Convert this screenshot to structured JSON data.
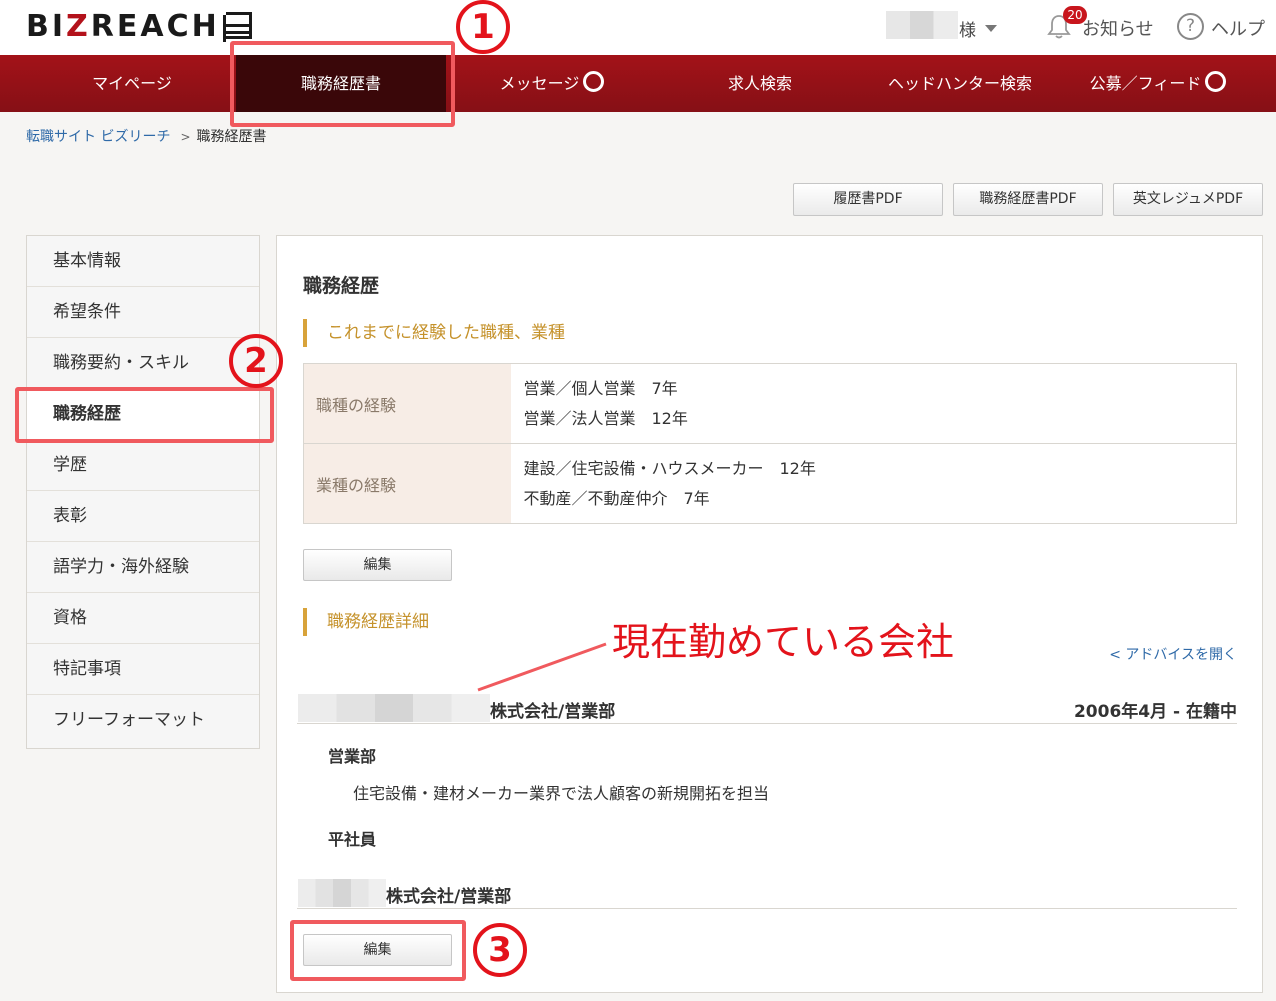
{
  "header": {
    "logo": "BIZREACH",
    "user_suffix": "様",
    "notice_badge": "20",
    "notice_label": "お知らせ",
    "help_glyph": "?",
    "help_label": "ヘルプ"
  },
  "nav": {
    "items": [
      {
        "label": "マイページ"
      },
      {
        "label": "職務経歴書"
      },
      {
        "label": "メッセージ"
      },
      {
        "label": "求人検索"
      },
      {
        "label": "ヘッドハンター検索"
      },
      {
        "label": "公募／フィード"
      }
    ]
  },
  "breadcrumb": {
    "home": "転職サイト ビズリーチ",
    "sep": ">",
    "current": "職務経歴書"
  },
  "pdf_buttons": [
    "履歴書PDF",
    "職務経歴書PDF",
    "英文レジュメPDF"
  ],
  "sidebar": {
    "items": [
      "基本情報",
      "希望条件",
      "職務要約・スキル",
      "職務経歴",
      "学歴",
      "表彰",
      "語学力・海外経験",
      "資格",
      "特記事項",
      "フリーフォーマット"
    ]
  },
  "main": {
    "title": "職務経歴",
    "experience_heading": "これまでに経験した職種、業種",
    "experience": [
      {
        "label": "職種の経験",
        "lines": [
          "営業／個人営業　7年",
          "営業／法人営業　12年"
        ]
      },
      {
        "label": "業種の経験",
        "lines": [
          "建設／住宅設備・ハウスメーカー　12年",
          "不動産／不動産仲介　7年"
        ]
      }
    ],
    "edit_label": "編集",
    "detail_heading": "職務経歴詳細",
    "advice_link": "< アドバイスを開く",
    "company1": {
      "name": "株式会社/営業部",
      "period": "2006年4月 - 在籍中",
      "department": "営業部",
      "description": "住宅設備・建材メーカー業界で法人顧客の新規開拓を担当",
      "role": "平社員"
    },
    "company2": {
      "name": "株式会社/営業部"
    }
  },
  "annotations": {
    "num1": "1",
    "num2": "2",
    "num3": "3",
    "current_company_note": "現在勤めている会社"
  },
  "colors": {
    "brand_red": "#a31218",
    "active_nav": "#3a0709",
    "annotation_red": "#e3131b",
    "heading_gold": "#c5922b",
    "link_blue": "#2f6aa8"
  }
}
